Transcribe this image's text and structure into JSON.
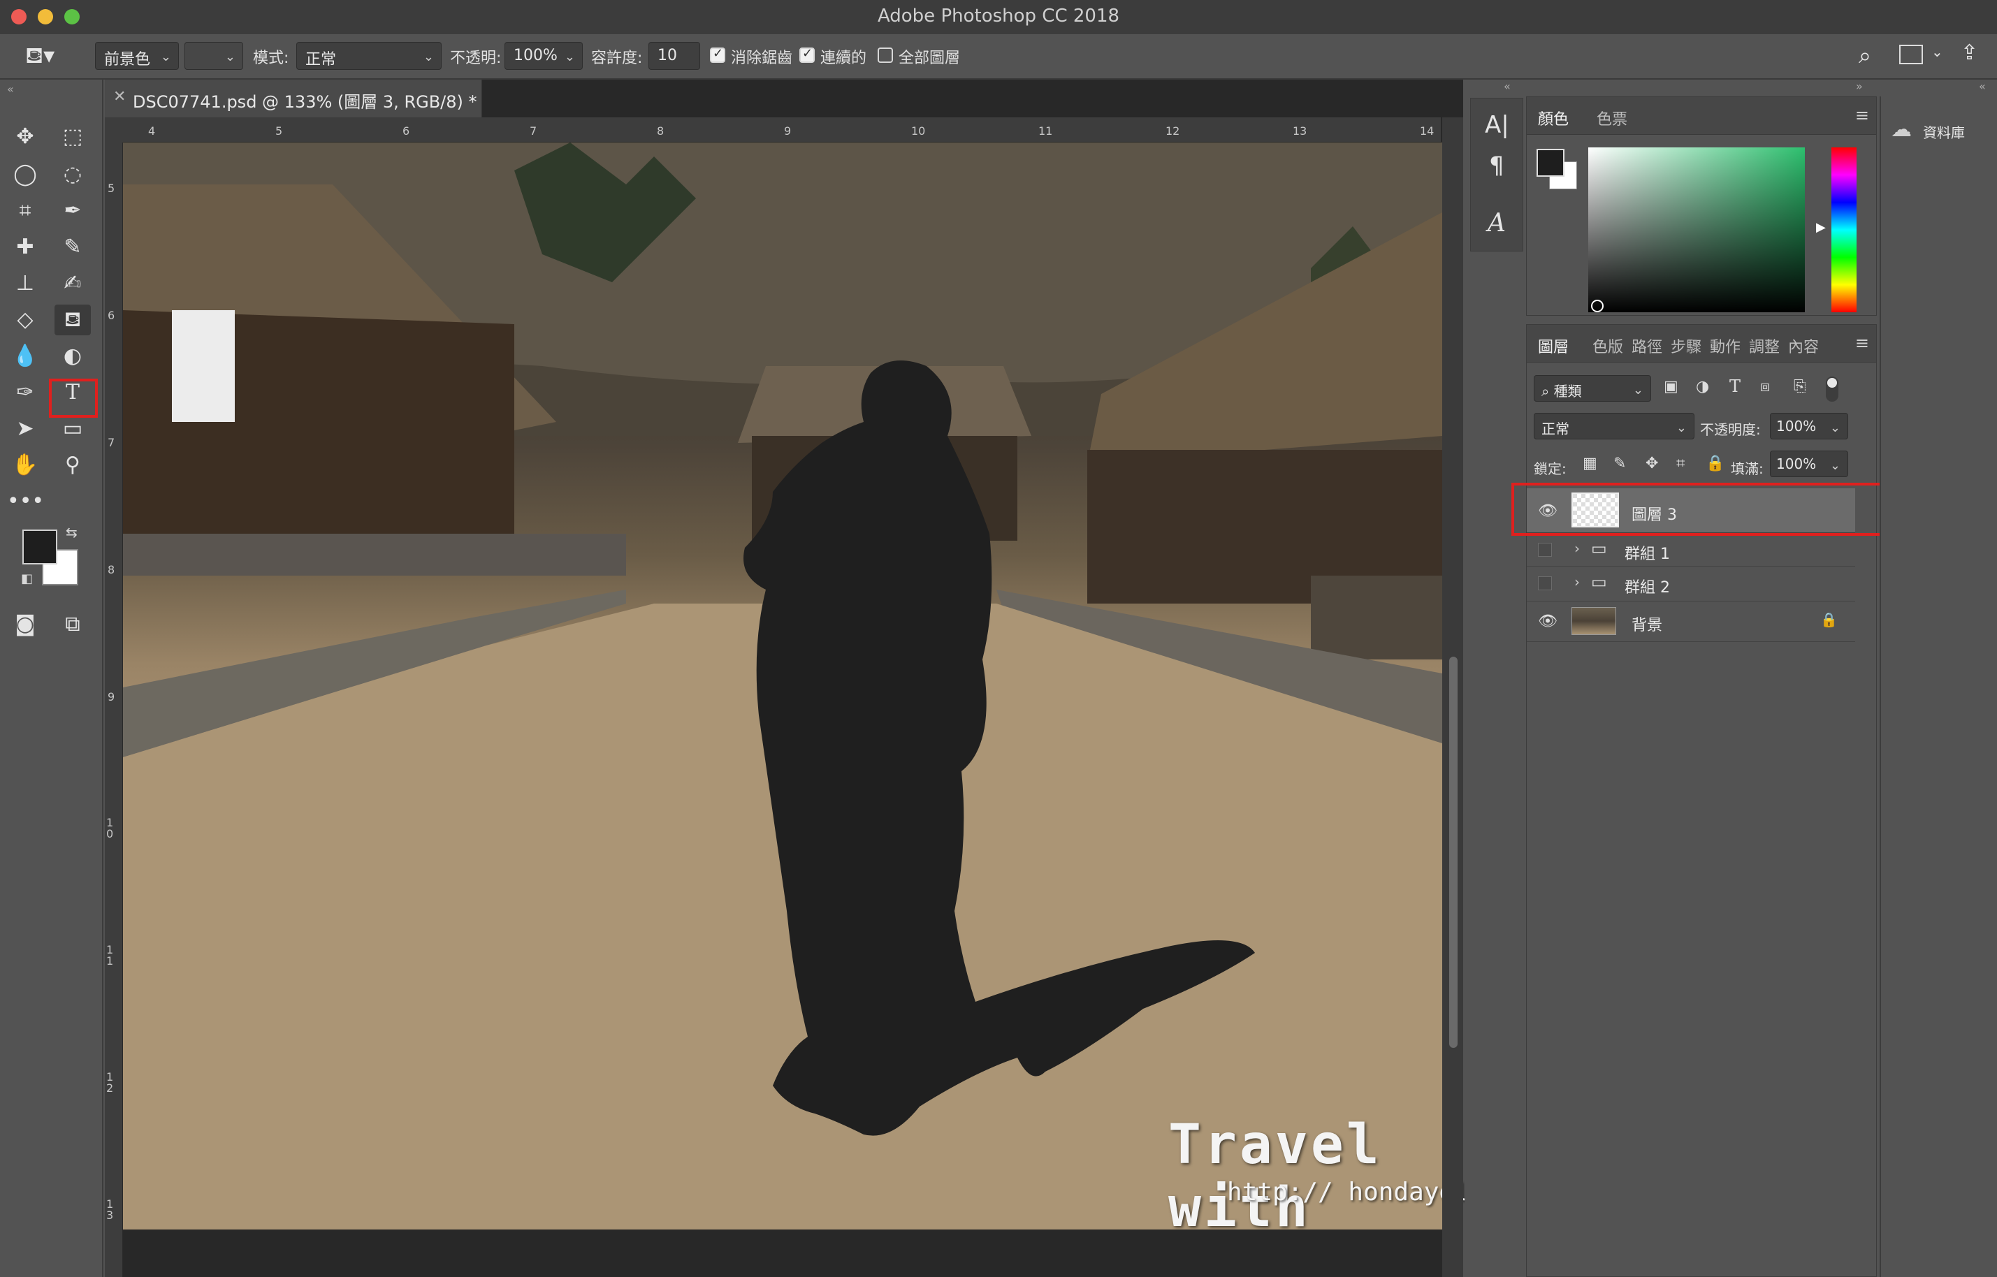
{
  "window": {
    "title": "Adobe Photoshop CC 2018"
  },
  "options_bar": {
    "fill_source": "前景色",
    "mode_label": "模式:",
    "mode_value": "正常",
    "opacity_label": "不透明:",
    "opacity_value": "100%",
    "tolerance_label": "容許度:",
    "tolerance_value": "10",
    "antialias_label": "消除鋸齒",
    "antialias_checked": true,
    "contiguous_label": "連續的",
    "contiguous_checked": true,
    "all_layers_label": "全部圖層",
    "all_layers_checked": false
  },
  "document": {
    "tab_title": "DSC07741.psd @ 133% (圖層 3, RGB/8) *",
    "ruler_top": [
      "4",
      "5",
      "6",
      "7",
      "8",
      "9",
      "10",
      "11",
      "12",
      "13",
      "14"
    ],
    "ruler_left": [
      "5",
      "6",
      "7",
      "8",
      "9",
      "10",
      "11",
      "12",
      "13"
    ]
  },
  "tools": {
    "selected": "paint-bucket",
    "type_tool_glyph": "T"
  },
  "color_panel": {
    "tabs": [
      "顏色",
      "色票"
    ],
    "foreground": "#1e1e1e",
    "background": "#ffffff"
  },
  "char_panel": {
    "char_glyph": "A|",
    "para_glyph": "¶",
    "glyph_glyph": "A"
  },
  "layers_panel": {
    "tabs": [
      "圖層",
      "色版",
      "路徑",
      "步驟",
      "動作",
      "調整",
      "內容"
    ],
    "filter_value": "種類",
    "blend_mode": "正常",
    "opacity_label": "不透明度:",
    "opacity_value": "100%",
    "lock_label": "鎖定:",
    "fill_label": "填滿:",
    "fill_value": "100%",
    "layers": [
      {
        "name": "圖層 3",
        "visible": true,
        "selected": true
      },
      {
        "name": "群組 1",
        "visible": false
      },
      {
        "name": "群組 2",
        "visible": false
      },
      {
        "name": "背景",
        "visible": true,
        "locked": true
      }
    ]
  },
  "libraries": {
    "label": "資料庫"
  },
  "watermark": {
    "line1": "Travel with Honda",
    "line2": "http:// hondayellow.pixnet.net"
  }
}
